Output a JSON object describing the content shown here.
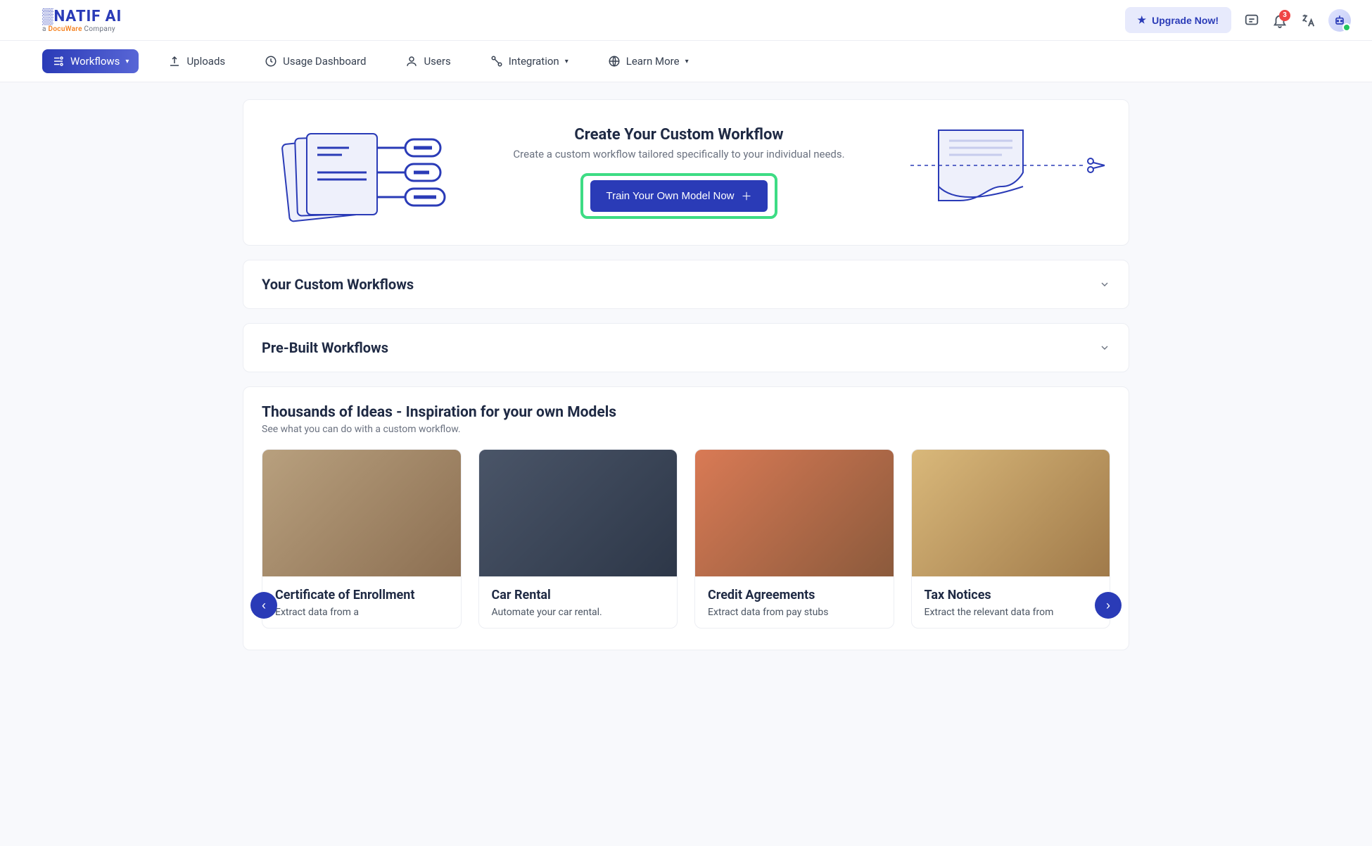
{
  "header": {
    "logo_main": "NATIF AI",
    "logo_sub_prefix": "a ",
    "logo_sub_brand": "DocuWare",
    "logo_sub_suffix": " Company",
    "upgrade_label": "Upgrade Now!",
    "notification_count": "3"
  },
  "nav": {
    "workflows": "Workflows",
    "uploads": "Uploads",
    "usage_dashboard": "Usage Dashboard",
    "users": "Users",
    "integration": "Integration",
    "learn_more": "Learn More"
  },
  "hero": {
    "title": "Create Your Custom Workflow",
    "subtitle": "Create a custom workflow tailored specifically to your individual needs.",
    "cta": "Train Your Own Model Now"
  },
  "sections": {
    "custom": "Your Custom Workflows",
    "prebuilt": "Pre-Built Workflows"
  },
  "ideas": {
    "title": "Thousands of Ideas - Inspiration for your own Models",
    "subtitle": "See what you can do with a custom workflow.",
    "cards": [
      {
        "title": "Certificate of Enrollment",
        "desc": "Extract data from a"
      },
      {
        "title": "Car Rental",
        "desc": "Automate your car rental."
      },
      {
        "title": "Credit Agreements",
        "desc": "Extract data from pay stubs"
      },
      {
        "title": "Tax Notices",
        "desc": "Extract the relevant data from"
      }
    ]
  }
}
